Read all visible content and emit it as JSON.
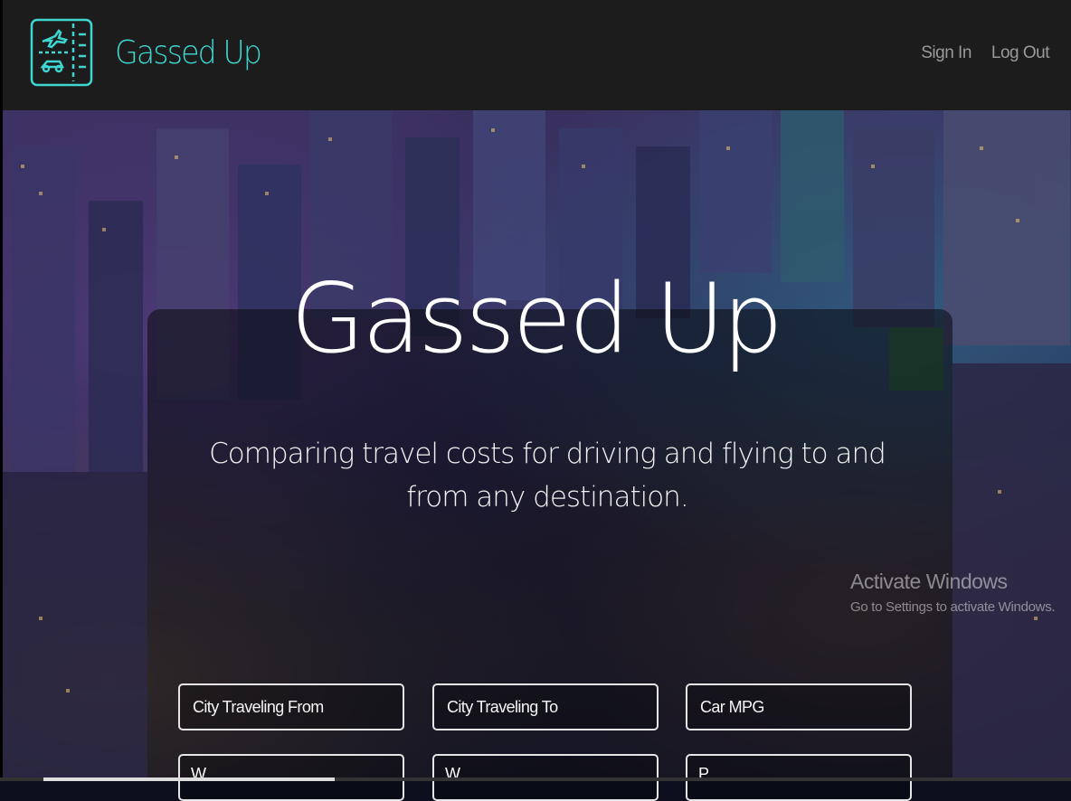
{
  "app": {
    "brand": "Gassed Up"
  },
  "nav": {
    "sign_in": "Sign In",
    "log_out": "Log Out"
  },
  "hero": {
    "title": "Gassed Up",
    "subtitle": "Comparing travel costs for driving and flying to and from any destination."
  },
  "form": {
    "from_placeholder": "City Traveling From",
    "to_placeholder": "City Traveling To",
    "mpg_placeholder": "Car MPG",
    "row2_a": "W",
    "row2_b": "W",
    "row2_c": "P"
  },
  "watermark": {
    "title": "Activate Windows",
    "subtitle": "Go to Settings to activate Windows."
  },
  "colors": {
    "accent": "#3ed6d0",
    "navbar": "#1c1c1c"
  }
}
